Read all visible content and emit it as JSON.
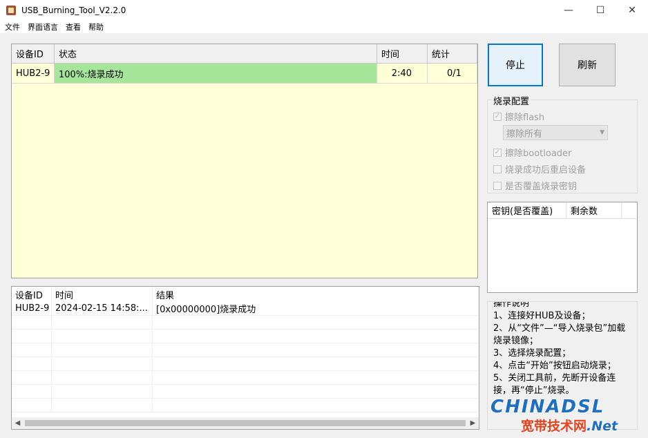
{
  "window": {
    "title": "USB_Burning_Tool_V2.2.0",
    "minimize": "—",
    "maximize": "☐",
    "close": "✕"
  },
  "menu": [
    "文件",
    "界面语言",
    "查看",
    "帮助"
  ],
  "device_table": {
    "headers": [
      "设备ID",
      "状态",
      "时间",
      "统计"
    ],
    "rows": [
      {
        "id": "HUB2-9",
        "status": "100%:烧录成功",
        "time": "2:40",
        "count": "0/1"
      }
    ]
  },
  "log_table": {
    "headers": [
      "设备ID",
      "时间",
      "结果"
    ],
    "rows": [
      {
        "id": "HUB2-9",
        "time": "2024-02-15 14:58:...",
        "result": "[0x00000000]烧录成功"
      }
    ]
  },
  "buttons": {
    "stop": "停止",
    "refresh": "刷新"
  },
  "burn_config": {
    "title": "烧录配置",
    "erase_flash": "擦除flash",
    "erase_mode": "擦除所有",
    "erase_bootloader": "擦除bootloader",
    "reboot_after": "烧录成功后重启设备",
    "overwrite_key": "是否覆盖烧录密钥"
  },
  "key_table": {
    "headers": [
      "密钥(是否覆盖)",
      "剩余数"
    ]
  },
  "instructions": {
    "title": "操作说明",
    "lines": [
      "1、连接好HUB及设备；",
      "2、从“文件”—“导入烧录包”加载",
      "烧录镜像；",
      "3、选择烧录配置；",
      "4、点击“开始”按钮启动烧录；",
      "5、关闭工具前，先断开设备连",
      "接，再“停止”烧录。"
    ]
  },
  "watermark": {
    "brand": "CHINADSL",
    "sub": "宽带技术网",
    "net": ".Net"
  },
  "colors": {
    "success_fill": "#a6e69b",
    "table_bg": "#ffffd8",
    "accent": "#0078d7"
  }
}
